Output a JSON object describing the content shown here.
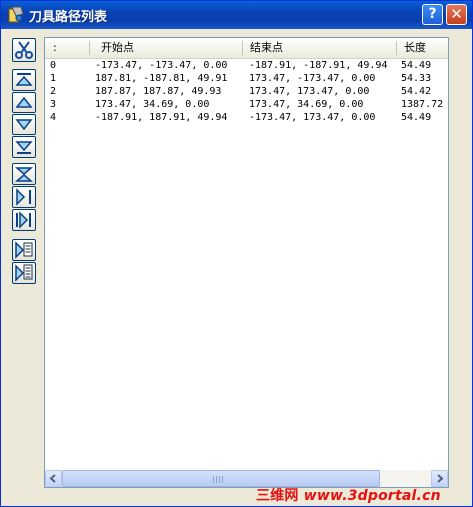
{
  "window": {
    "title": "刀具路径列表",
    "help_label": "?",
    "close_label": "✕"
  },
  "toolbar": {
    "buttons": [
      {
        "name": "scissors-icon"
      },
      {
        "name": "move-first-icon"
      },
      {
        "name": "move-up-icon"
      },
      {
        "name": "move-down-icon"
      },
      {
        "name": "move-last-icon"
      },
      {
        "name": "reverse-vertical-icon"
      },
      {
        "name": "reverse-horizontal-icon"
      },
      {
        "name": "reverse-order-icon"
      },
      {
        "name": "export-icon"
      },
      {
        "name": "export-all-icon"
      }
    ]
  },
  "table": {
    "columns": [
      ":",
      "开始点",
      "结束点",
      "长度"
    ],
    "rows": [
      [
        "0",
        "-173.47, -173.47, 0.00",
        "-187.91, -187.91, 49.94",
        "54.49"
      ],
      [
        "1",
        "187.81, -187.81, 49.91",
        "173.47, -173.47, 0.00",
        "54.33"
      ],
      [
        "2",
        "187.87, 187.87, 49.93",
        "173.47, 173.47, 0.00",
        "54.42"
      ],
      [
        "3",
        "173.47, 34.69, 0.00",
        "173.47, 34.69, 0.00",
        "1387.72"
      ],
      [
        "4",
        "-187.91, 187.91, 49.94",
        "-173.47, 173.47, 0.00",
        "54.49"
      ]
    ]
  },
  "watermark": {
    "cn": "三维网",
    "url": "www.3dportal.cn"
  },
  "colors": {
    "title_bar": "#0842b5",
    "window_bg": "#ece9d8",
    "watermark": "#e81010"
  }
}
